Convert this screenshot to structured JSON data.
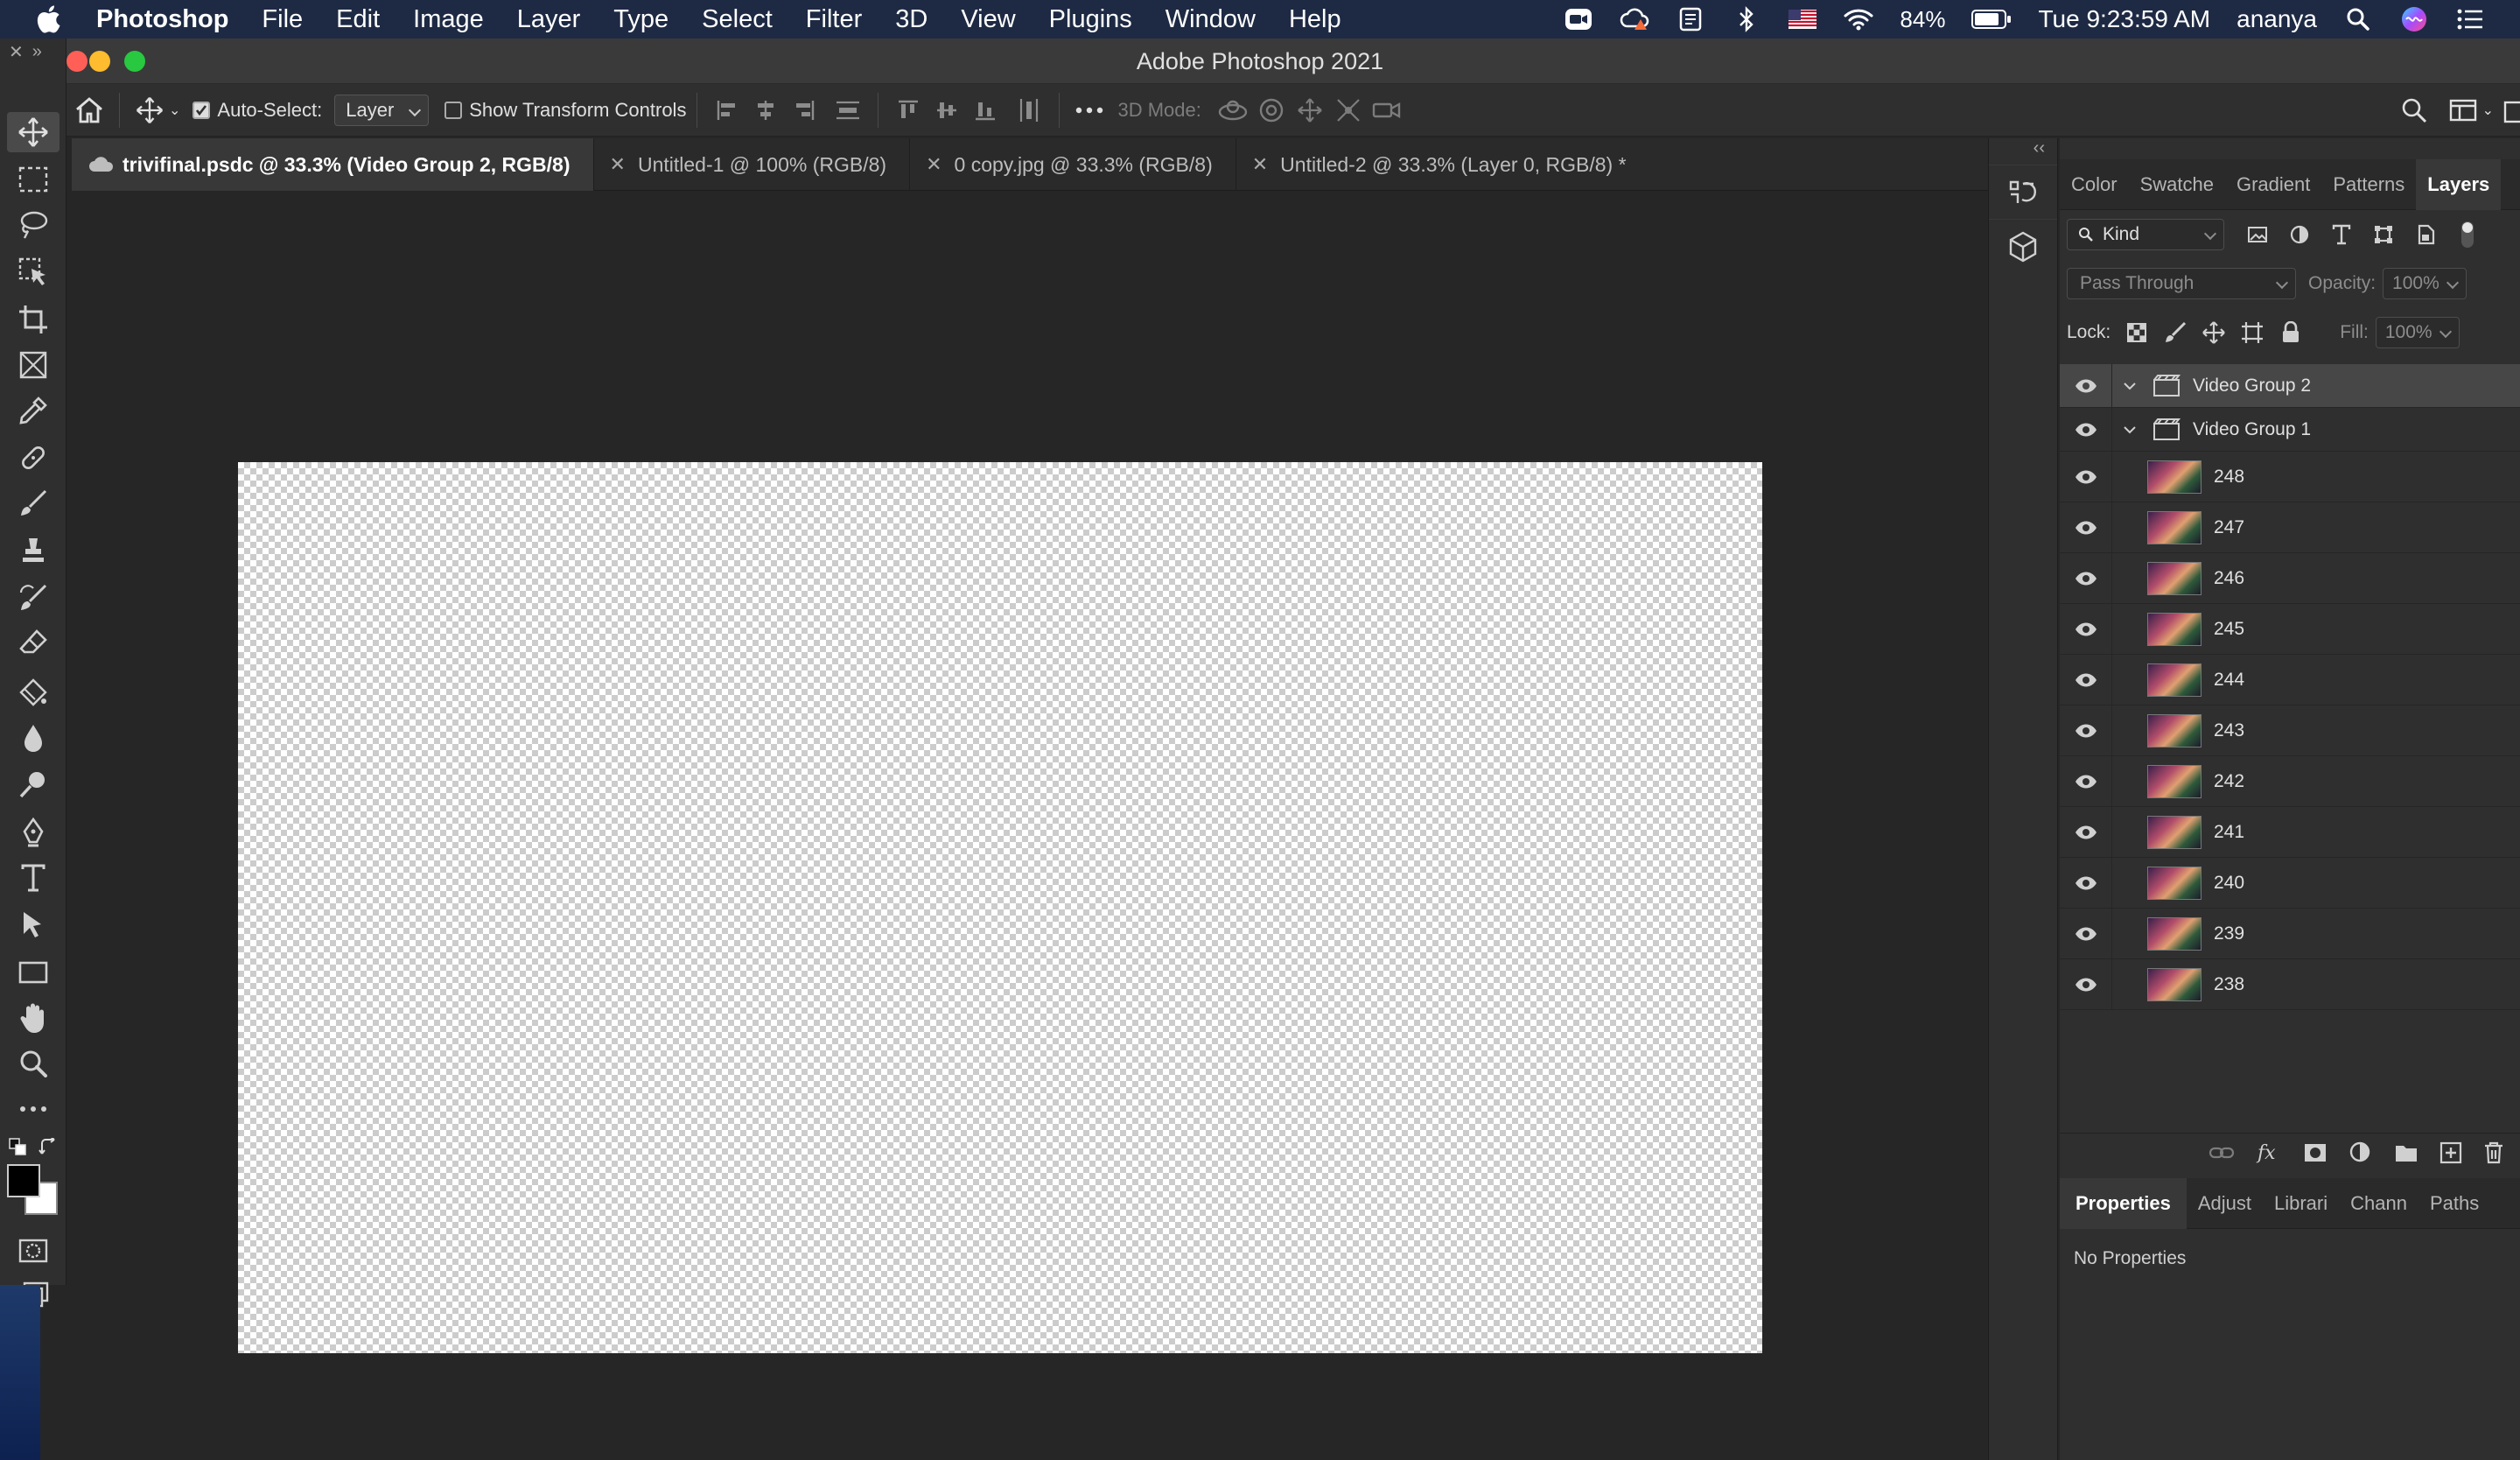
{
  "menubar": {
    "items": [
      "Photoshop",
      "File",
      "Edit",
      "Image",
      "Layer",
      "Type",
      "Select",
      "Filter",
      "3D",
      "View",
      "Plugins",
      "Window",
      "Help"
    ],
    "battery": "84%",
    "clock": "Tue 9:23:59 AM",
    "user": "ananya"
  },
  "window": {
    "title": "Adobe Photoshop 2021"
  },
  "options": {
    "auto_select_label": "Auto-Select:",
    "auto_select_checked": true,
    "auto_select_value": "Layer",
    "transform_label": "Show Transform Controls",
    "transform_checked": false,
    "three_d_mode_label": "3D Mode:"
  },
  "tabs": [
    {
      "label": "trivifinal.psdc @ 33.3% (Video Group 2, RGB/8)",
      "active": true
    },
    {
      "label": "Untitled-1 @ 100% (RGB/8)",
      "active": false
    },
    {
      "label": "0 copy.jpg @ 33.3% (RGB/8)",
      "active": false
    },
    {
      "label": "Untitled-2 @ 33.3% (Layer 0, RGB/8) *",
      "active": false
    }
  ],
  "panel_tabs": [
    "Color",
    "Swatche",
    "Gradient",
    "Patterns",
    "Layers"
  ],
  "layers_panel": {
    "filter_kind": "Kind",
    "blend_mode": "Pass Through",
    "opacity_label": "Opacity:",
    "opacity_value": "100%",
    "lock_label": "Lock:",
    "fill_label": "Fill:",
    "fill_value": "100%"
  },
  "layers": [
    {
      "name": "Video Group 2",
      "kind": "group",
      "selected": true
    },
    {
      "name": "Video Group 1",
      "kind": "group",
      "selected": false
    },
    {
      "name": "248",
      "kind": "frame"
    },
    {
      "name": "247",
      "kind": "frame"
    },
    {
      "name": "246",
      "kind": "frame"
    },
    {
      "name": "245",
      "kind": "frame"
    },
    {
      "name": "244",
      "kind": "frame"
    },
    {
      "name": "243",
      "kind": "frame"
    },
    {
      "name": "242",
      "kind": "frame"
    },
    {
      "name": "241",
      "kind": "frame"
    },
    {
      "name": "240",
      "kind": "frame"
    },
    {
      "name": "239",
      "kind": "frame"
    },
    {
      "name": "238",
      "kind": "frame"
    }
  ],
  "props_tabs": [
    "Properties",
    "Adjust",
    "Librari",
    "Chann",
    "Paths"
  ],
  "properties": {
    "empty_text": "No Properties"
  },
  "colors": {
    "menubar": "#1e2a44",
    "canvas_checker": "#cccccc",
    "close": "#ff5f57",
    "minimize": "#febc2e",
    "zoom": "#28c840"
  }
}
